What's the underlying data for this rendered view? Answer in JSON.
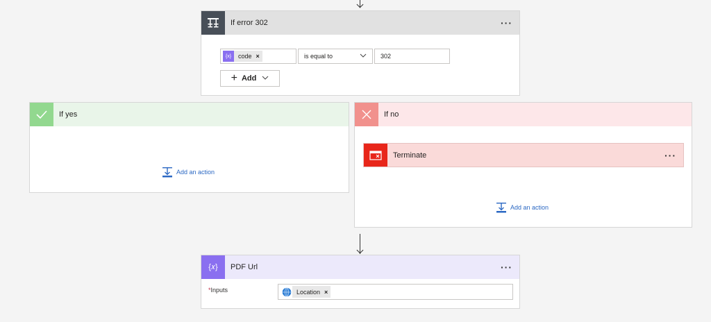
{
  "top_arrow": {
    "icon": "down-arrow-icon"
  },
  "condition": {
    "title": "If error 302",
    "icon": "condition-icon",
    "header_color": "#e1e1e1",
    "icon_bg": "#484f58",
    "menu": "···",
    "left_token": {
      "label": "code",
      "remove": "×",
      "icon": "variable-icon"
    },
    "operator": "is equal to",
    "right_value": "302",
    "add_button": "Add"
  },
  "if_yes": {
    "title": "If yes",
    "header_color": "#e9f5e9",
    "icon_bg": "#92d88f",
    "add_action": "Add an action"
  },
  "if_no": {
    "title": "If no",
    "header_color": "#fde7e9",
    "icon_bg": "#f1918d",
    "terminate": {
      "title": "Terminate",
      "menu": "···",
      "header_color": "#fadad9",
      "icon_bg": "#e8261a"
    },
    "add_action": "Add an action"
  },
  "pdf_url": {
    "title": "PDF Url",
    "header_color": "#ece9fb",
    "icon_bg": "#8a6ff0",
    "menu": "···",
    "inputs_label": "Inputs",
    "required_marker": "*",
    "token": {
      "label": "Location",
      "remove": "×",
      "icon": "globe-icon"
    }
  }
}
